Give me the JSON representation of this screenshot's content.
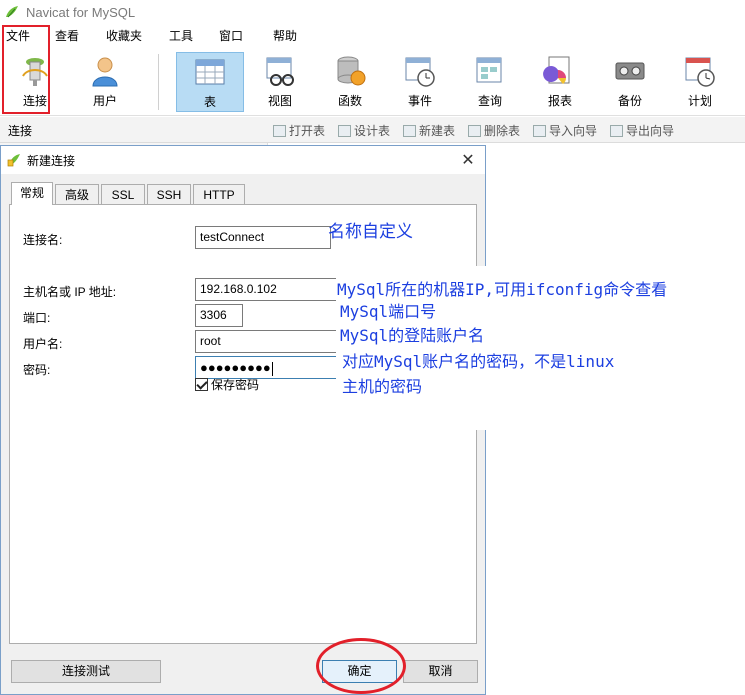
{
  "window": {
    "title": "Navicat for MySQL"
  },
  "menubar": {
    "items": [
      "文件",
      "查看",
      "收藏夹",
      "工具",
      "窗口",
      "帮助"
    ]
  },
  "toolbar": {
    "connect": "连接",
    "user": "用户",
    "table": "表",
    "view": "视图",
    "function": "函数",
    "event": "事件",
    "query": "查询",
    "report": "报表",
    "backup": "备份",
    "schedule": "计划"
  },
  "subbar": {
    "connection": "连接",
    "actions": [
      "打开表",
      "设计表",
      "新建表",
      "删除表",
      "导入向导",
      "导出向导"
    ]
  },
  "dialog": {
    "title": "新建连接",
    "close": "✕",
    "tabs": [
      "常规",
      "高级",
      "SSL",
      "SSH",
      "HTTP"
    ],
    "fields": {
      "conn_name_label": "连接名:",
      "conn_name": "testConnect",
      "host_label": "主机名或 IP 地址:",
      "host": "192.168.0.102",
      "port_label": "端口:",
      "port": "3306",
      "user_label": "用户名:",
      "user": "root",
      "password_label": "密码:",
      "password": "●●●●●●●●●"
    },
    "save_password": "保存密码",
    "test_button": "连接测试",
    "ok_button": "确定",
    "cancel_button": "取消"
  },
  "annotations": {
    "name": "名称自定义",
    "host": "MySql所在的机器IP,可用ifconfig命令查看",
    "port": "MySql端口号",
    "user": "MySql的登陆账户名",
    "password_1": "对应MySql账户名的密码，不是linux",
    "password_2": "主机的密码"
  },
  "colors": {
    "accent": "#b8dcf4",
    "annotation": "#1c3fe0",
    "highlight": "#e2202a"
  }
}
